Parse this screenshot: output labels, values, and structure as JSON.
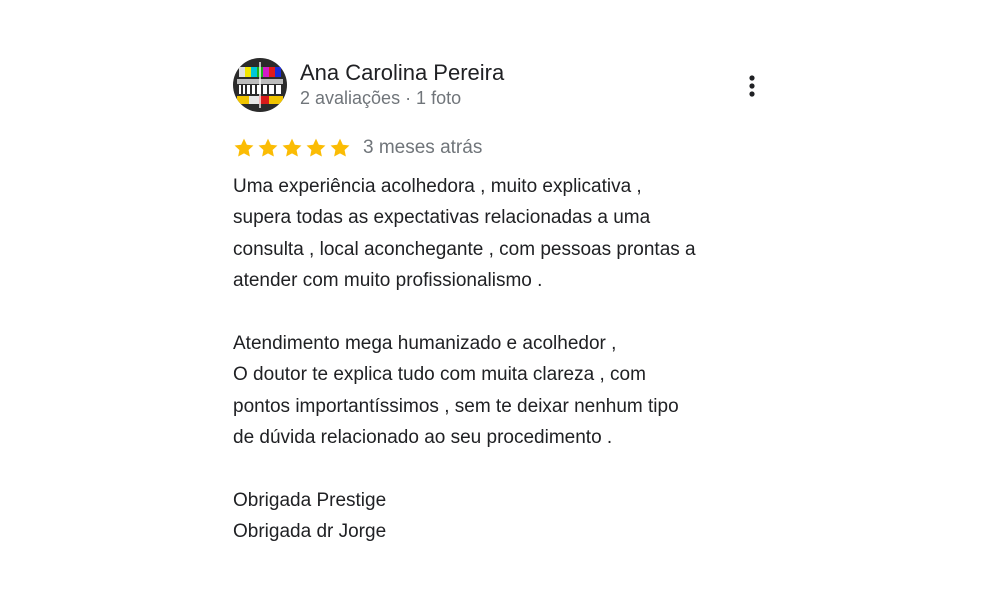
{
  "review": {
    "author_name": "Ana Carolina Pereira",
    "author_meta": "2 avaliações · 1 foto",
    "rating": 5,
    "rating_max": 5,
    "star_color": "#fbbc04",
    "time_ago": "3 meses atrás",
    "text_lines": [
      "Uma experiência acolhedora , muito explicativa ,",
      "supera todas as expectativas relacionadas a uma",
      "consulta , local aconchegante , com pessoas prontas a",
      "atender com muito profissionalismo .",
      "",
      "Atendimento mega humanizado e acolhedor ,",
      "O doutor te explica tudo com muita clareza , com",
      "pontos importantíssimos , sem te deixar nenhum tipo",
      "de dúvida relacionado ao seu procedimento .",
      "",
      "Obrigada Prestige",
      "Obrigada dr Jorge"
    ]
  },
  "icons": {
    "avatar": "avatar-image",
    "more": "more-vert-icon",
    "star": "star-icon"
  }
}
